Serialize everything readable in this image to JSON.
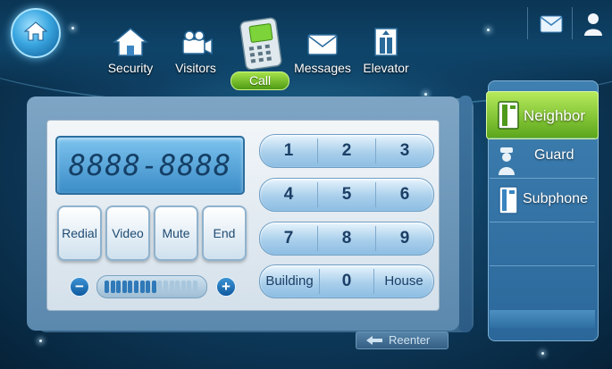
{
  "nav": {
    "items": [
      {
        "label": "Security",
        "icon": "house-icon"
      },
      {
        "label": "Visitors",
        "icon": "camera-icon"
      },
      {
        "label": "Call",
        "icon": "intercom-icon",
        "active": true
      },
      {
        "label": "Messages",
        "icon": "envelope-icon"
      },
      {
        "label": "Elevator",
        "icon": "elevator-icon"
      }
    ]
  },
  "top_right": {
    "mail_icon": "mail-icon",
    "user_icon": "user-icon"
  },
  "display": {
    "number": "8888-8888"
  },
  "function_buttons": {
    "redial": "Redial",
    "video": "Video",
    "mute": "Mute",
    "end": "End"
  },
  "volume": {
    "minus": "−",
    "plus": "+",
    "level": 0.55
  },
  "keypad": {
    "rows": [
      [
        "1",
        "2",
        "3"
      ],
      [
        "4",
        "5",
        "6"
      ],
      [
        "7",
        "8",
        "9"
      ],
      [
        "Building",
        "0",
        "House"
      ]
    ]
  },
  "side_tabs": {
    "neighbor": "Neighbor",
    "guard": "Guard",
    "subphone": "Subphone"
  },
  "reenter": {
    "label": "Reenter"
  },
  "colors": {
    "accent_green": "#6bbd25",
    "panel_blue": "#5b88ad",
    "key_text": "#1c3f66"
  }
}
